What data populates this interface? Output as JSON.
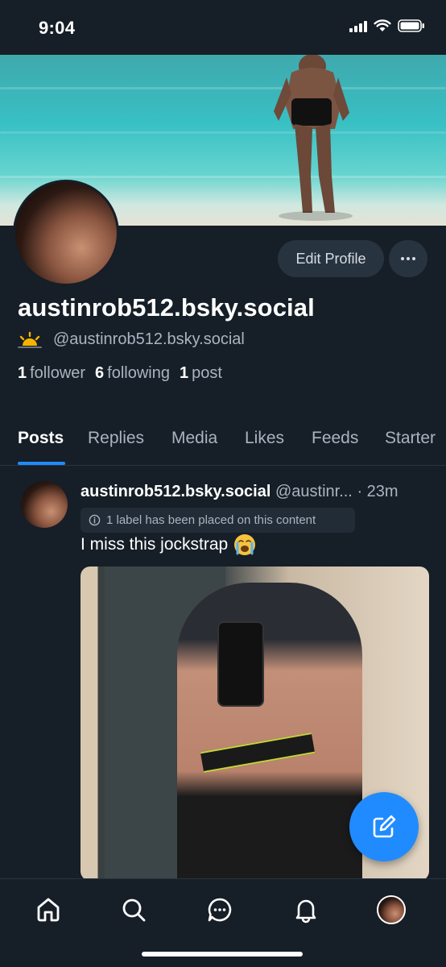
{
  "status_bar": {
    "time": "9:04"
  },
  "profile": {
    "display_name": "austinrob512.bsky.social",
    "handle": "@austinrob512.bsky.social",
    "edit_button": "Edit Profile",
    "stats": {
      "followers_count": "1",
      "followers_label": "follower",
      "following_count": "6",
      "following_label": "following",
      "posts_count": "1",
      "posts_label": "post"
    }
  },
  "tabs": [
    "Posts",
    "Replies",
    "Media",
    "Likes",
    "Feeds",
    "Starter"
  ],
  "active_tab": "Posts",
  "post": {
    "author": "austinrob512.bsky.social",
    "handle": "@austinr...",
    "separator": "·",
    "time": "23m",
    "label_notice": "1 label has been placed on this content",
    "text": "I miss this jockstrap",
    "emoji": "loudly-crying-face"
  },
  "icons": {
    "handle_badge": "sunrise-icon",
    "label": "info-icon",
    "fab": "compose-icon",
    "nav": [
      "home-icon",
      "search-icon",
      "chat-icon",
      "bell-icon",
      "avatar"
    ]
  },
  "colors": {
    "background": "#161e27",
    "accent": "#208bfe",
    "muted_text": "#aab4c0"
  }
}
